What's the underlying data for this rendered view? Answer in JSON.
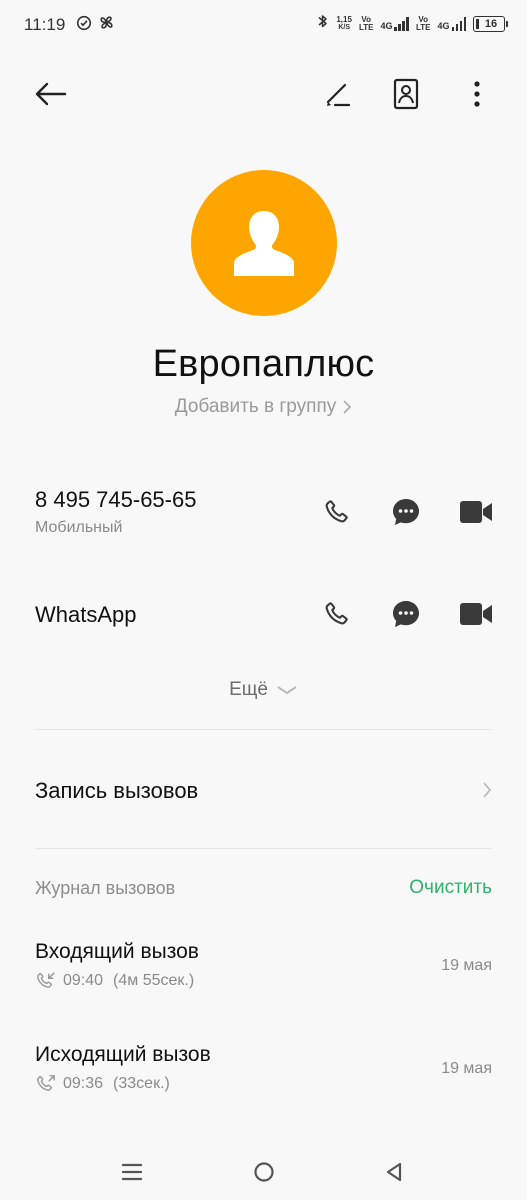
{
  "status_bar": {
    "time": "11:19",
    "speed_value": "1,15",
    "speed_unit": "K/S",
    "vo_lte_1": "Vo",
    "lte_1": "LTE",
    "net_1": "4G",
    "vo_lte_2": "Vo",
    "lte_2": "LTE",
    "net_2": "4G",
    "battery": "16"
  },
  "contact": {
    "name": "Европаплюс",
    "add_group": "Добавить в группу"
  },
  "phone": {
    "number": "8 495 745-65-65",
    "type": "Мобильный"
  },
  "whatsapp": {
    "label": "WhatsApp"
  },
  "more_label": "Ещё",
  "call_recording": {
    "label": "Запись вызовов"
  },
  "call_log": {
    "title": "Журнал вызовов",
    "clear_label": "Очистить",
    "entries": [
      {
        "type": "Входящий вызов",
        "time": "09:40",
        "duration": "(4м 55сек.)",
        "date": "19 мая"
      },
      {
        "type": "Исходящий вызов",
        "time": "09:36",
        "duration": "(33сек.)",
        "date": "19 мая"
      }
    ]
  },
  "colors": {
    "avatar": "#ffa500",
    "accent_green": "#2fb36a",
    "icon_dark": "#3a3a3a"
  }
}
